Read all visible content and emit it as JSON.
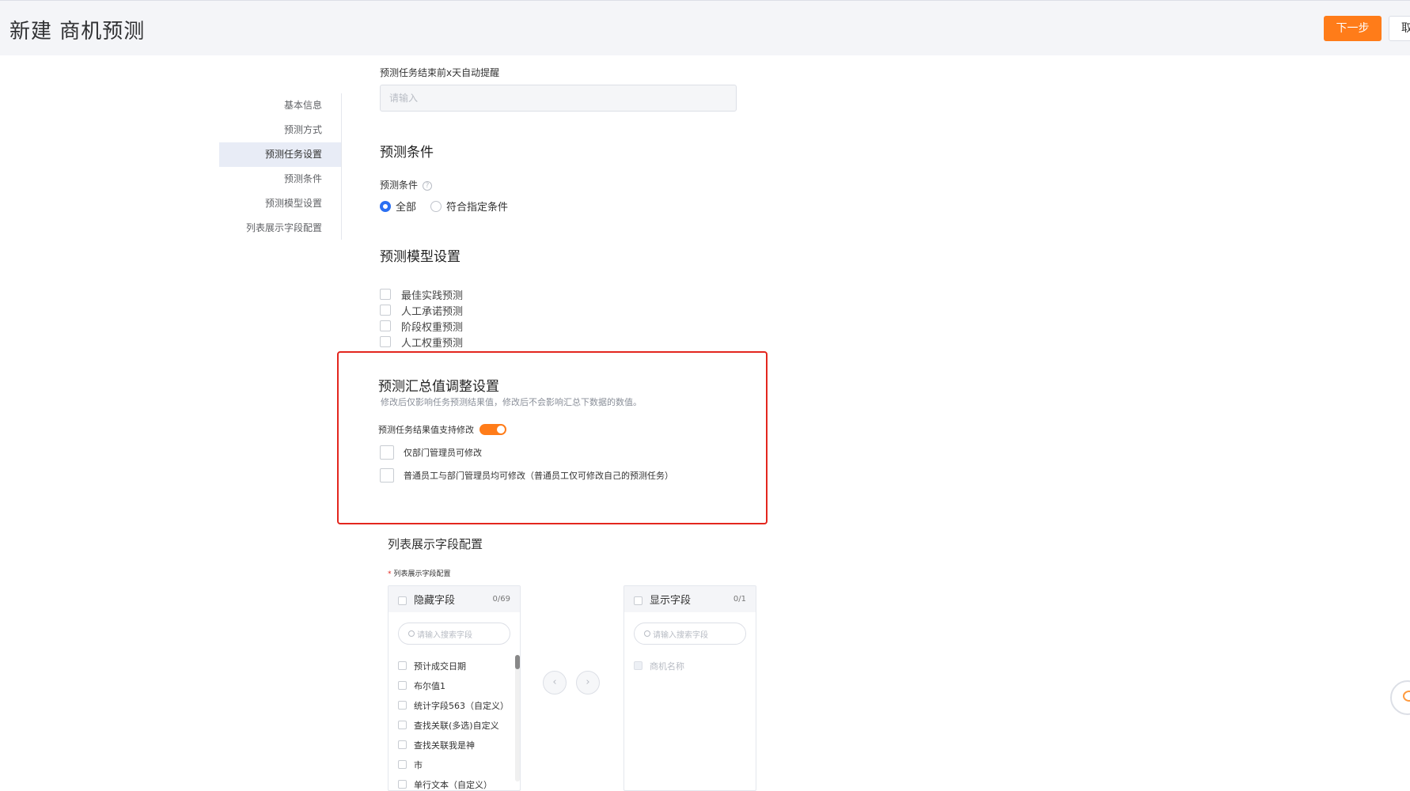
{
  "header": {
    "title": "新建 商机预测",
    "next_label": "下一步",
    "cancel_label": "取消"
  },
  "anchor_nav": {
    "items": [
      "基本信息",
      "预测方式",
      "预测任务设置",
      "预测条件",
      "预测模型设置",
      "列表展示字段配置"
    ],
    "active_index": 2
  },
  "task_settings": {
    "reminder_label": "预测任务结束前x天自动提醒",
    "reminder_placeholder": "请输入"
  },
  "conditions": {
    "section_title": "预测条件",
    "field_label": "预测条件",
    "options": [
      "全部",
      "符合指定条件"
    ],
    "selected": "全部"
  },
  "model_settings": {
    "section_title": "预测模型设置",
    "options": [
      "最佳实践预测",
      "人工承诺预测",
      "阶段权重预测",
      "人工权重预测"
    ]
  },
  "summary_adjust": {
    "title": "预测汇总值调整设置",
    "description": "修改后仅影响任务预测结果值，修改后不会影响汇总下数据的数值。",
    "toggle_label": "预测任务结果值支持修改",
    "toggle_on": true,
    "permissions": [
      "仅部门管理员可修改",
      "普通员工与部门管理员均可修改（普通员工仅可修改自己的预测任务）"
    ],
    "highlight_color": "#e3261e"
  },
  "list_config": {
    "section_title": "列表展示字段配置",
    "field_label": "列表展示字段配置",
    "hidden_panel": {
      "title": "隐藏字段",
      "count": "0/69",
      "search_placeholder": "请输入搜索字段",
      "items": [
        "预计成交日期",
        "布尔值1",
        "统计字段563（自定义）",
        "查找关联(多选)自定义",
        "查找关联我是神",
        "市",
        "单行文本（自定义）"
      ]
    },
    "shown_panel": {
      "title": "显示字段",
      "count": "0/1",
      "search_placeholder": "请输入搜索字段",
      "items": [
        "商机名称"
      ]
    }
  },
  "colors": {
    "accent": "#ff7c19",
    "radio_blue": "#2a6ff2"
  }
}
